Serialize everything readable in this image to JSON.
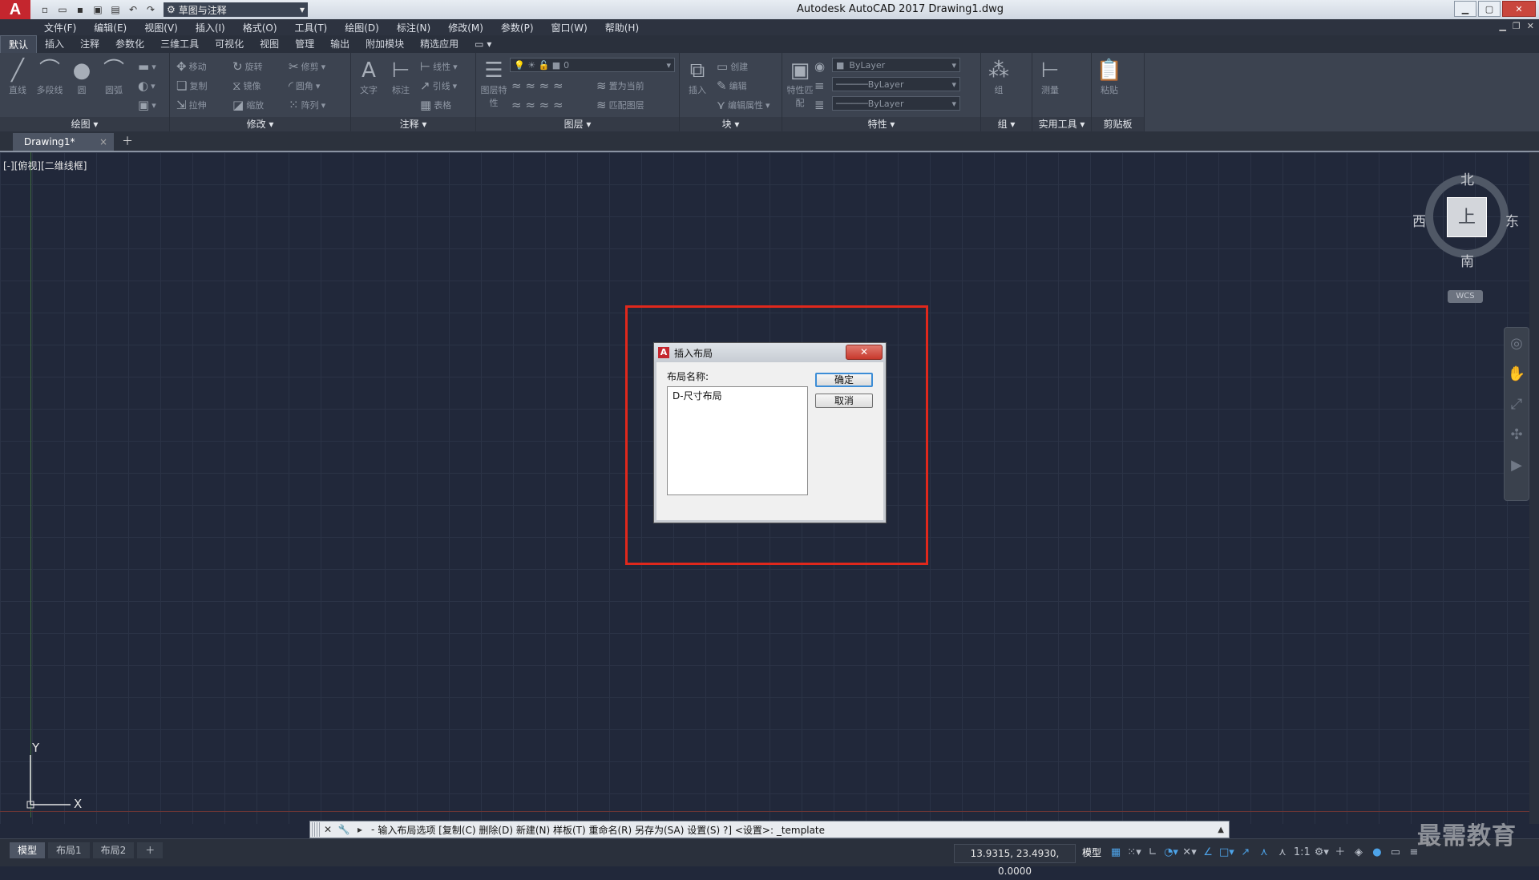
{
  "app": {
    "logo_letter": "A",
    "title": "Autodesk AutoCAD 2017    Drawing1.dwg",
    "workspace": "草图与注释"
  },
  "menu": [
    "文件(F)",
    "编辑(E)",
    "视图(V)",
    "插入(I)",
    "格式(O)",
    "工具(T)",
    "绘图(D)",
    "标注(N)",
    "修改(M)",
    "参数(P)",
    "窗口(W)",
    "帮助(H)"
  ],
  "ribbon_tabs": [
    "默认",
    "插入",
    "注释",
    "参数化",
    "三维工具",
    "可视化",
    "视图",
    "管理",
    "输出",
    "附加模块",
    "精选应用"
  ],
  "ribbon": {
    "draw": {
      "title": "绘图 ▾",
      "tools": [
        "直线",
        "多段线",
        "圆",
        "圆弧"
      ]
    },
    "modify": {
      "title": "修改 ▾",
      "tools": [
        "移动",
        "旋转",
        "修剪",
        "复制",
        "镜像",
        "圆角",
        "拉伸",
        "缩放",
        "阵列"
      ]
    },
    "annotate": {
      "title": "注释 ▾",
      "tools": [
        "文字",
        "标注",
        "线性",
        "引线",
        "表格"
      ]
    },
    "layers": {
      "title": "图层 ▾",
      "layer_name": "0",
      "tools": [
        "图层特性",
        "置为当前",
        "匹配图层"
      ]
    },
    "block": {
      "title": "块 ▾",
      "tools": [
        "插入",
        "创建",
        "编辑",
        "编辑属性"
      ]
    },
    "properties": {
      "title": "特性 ▾",
      "color": "ByLayer",
      "linetype": "ByLayer",
      "lineweight": "ByLayer",
      "tools": [
        "特性匹配"
      ]
    },
    "groups": {
      "title": "组 ▾",
      "tools": [
        "组"
      ]
    },
    "utilities": {
      "title": "实用工具 ▾",
      "tools": [
        "测量"
      ]
    },
    "clipboard": {
      "title": "剪贴板",
      "tools": [
        "粘贴"
      ]
    }
  },
  "file_tab": {
    "label": "Drawing1*"
  },
  "viewport_label": "[-][俯视][二维线框]",
  "ucs": {
    "y": "Y",
    "x": "X"
  },
  "viewcube": {
    "north": "北",
    "south": "南",
    "east": "东",
    "west": "西",
    "face": "上",
    "wcs": "WCS"
  },
  "dialog": {
    "title": "插入布局",
    "label": "布局名称:",
    "items": [
      "D-尺寸布局"
    ],
    "ok": "确定",
    "cancel": "取消"
  },
  "command_line": {
    "prompt": "-",
    "text": "输入布局选项 [复制(C) 删除(D) 新建(N) 样板(T) 重命名(R) 另存为(SA) 设置(S) ?] <设置>: _template"
  },
  "status": {
    "layout_tabs": [
      "模型",
      "布局1",
      "布局2"
    ],
    "coords": "13.9315, 23.4930, 0.0000",
    "model": "模型",
    "scale": "1:1"
  },
  "watermark": "最需教育",
  "colors": {
    "background": "#21283a",
    "highlight": "#e0281c",
    "brand": "#c4262e"
  }
}
